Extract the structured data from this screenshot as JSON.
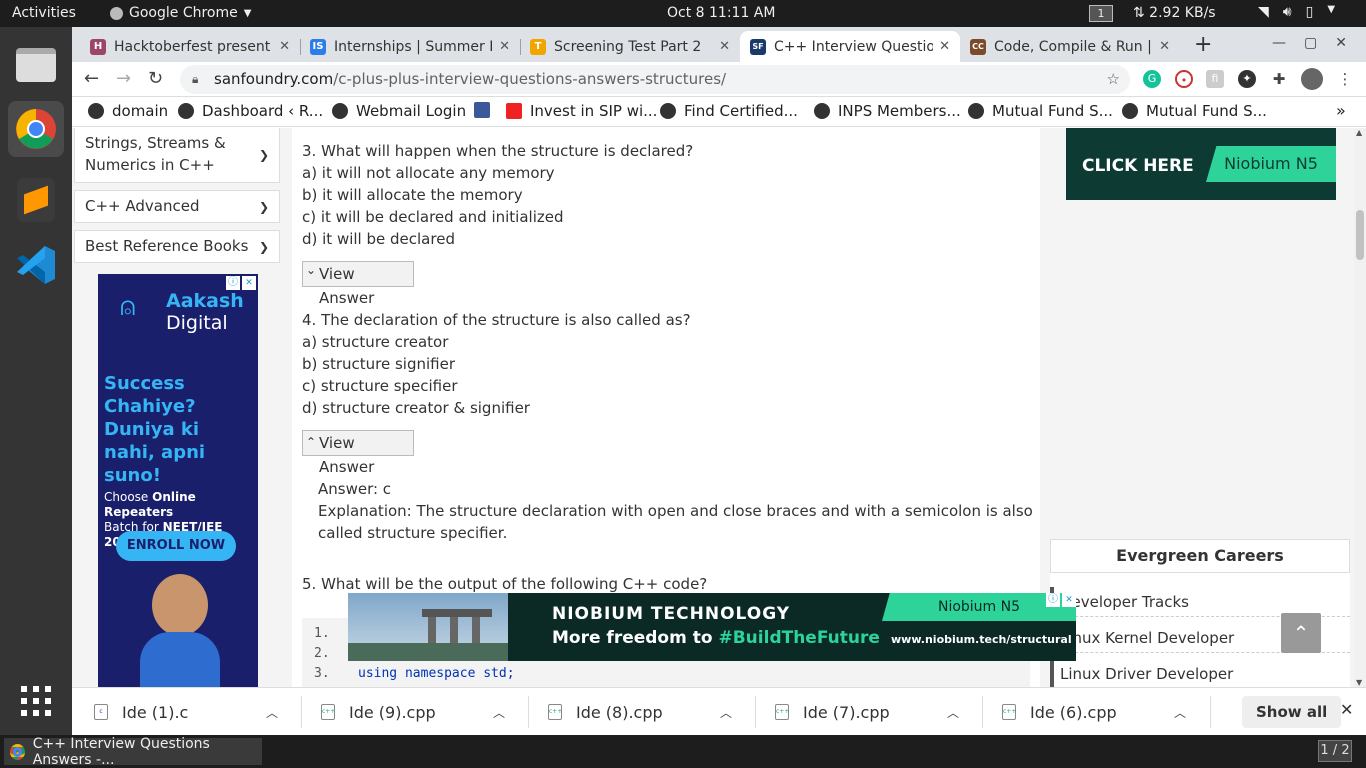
{
  "topbar": {
    "activities": "Activities",
    "app_menu": "Google Chrome",
    "clock": "Oct 8  11:11 AM",
    "workspace": "1",
    "net_speed": "⇅ 2.92 KB/s"
  },
  "tabs": [
    {
      "title": "Hacktoberfest present",
      "fav": "H",
      "fav_color": "#9c4668"
    },
    {
      "title": "Internships | Summer I",
      "fav": "IS",
      "fav_color": "#2b7de9"
    },
    {
      "title": "Screening Test Part 2",
      "fav": "T",
      "fav_color": "#f0a500"
    },
    {
      "title": "C++ Interview Question",
      "fav": "SF",
      "fav_color": "#1a3a6b"
    },
    {
      "title": "Code, Compile & Run |",
      "fav": "CC",
      "fav_color": "#7b4a2a"
    }
  ],
  "url": {
    "host": "sanfoundry.com",
    "path": "/c-plus-plus-interview-questions-answers-structures/"
  },
  "bookmarks": [
    "domain",
    "Dashboard ‹ R...",
    "Webmail Login",
    "Invest in SIP wi...",
    "Find Certified...",
    "INPS Members...",
    "Mutual Fund S...",
    "Mutual Fund S..."
  ],
  "sidebar": {
    "items": [
      "Strings, Streams & Numerics in C++",
      "C++ Advanced",
      "Best Reference Books"
    ]
  },
  "ad_left": {
    "brand1": "Aakash",
    "brand2": "Digital",
    "headline": "Success Chahiye? Duniya ki nahi, apni suno!",
    "sub1": "Choose ",
    "sub1b": "Online Repeaters",
    "sub2": "Batch for ",
    "sub2b": "NEET/JEE 2021",
    "cta": "ENROLL NOW"
  },
  "q3": {
    "question": "3. What will happen when the structure is declared?",
    "a": "a) it will not allocate any memory",
    "b": "b) it will allocate the memory",
    "c": "c) it will be declared and initialized",
    "d": "d) it will be declared"
  },
  "q4": {
    "question": "4. The declaration of the structure is also called as?",
    "a": "a) structure creator",
    "b": "b) structure signifier",
    "c": "c) structure specifier",
    "d": "d) structure creator & signifier"
  },
  "view_answer": "View Answer",
  "answer": {
    "label": "Answer: c",
    "explanation": "Explanation: The structure declaration with open and close braces and with a semicolon is also called structure specifier."
  },
  "q5": {
    "question": "5. What will be the output of the following C++ code?"
  },
  "code": {
    "lines": [
      "1.",
      "2.",
      "3."
    ],
    "line3": "using namespace std;"
  },
  "ad_right": {
    "cta": "CLICK HERE",
    "brand": "Niobium N5"
  },
  "careers": {
    "title": "Evergreen Careers",
    "items": [
      "Developer Tracks",
      "Linux Kernel Developer",
      "Linux Driver Developer"
    ]
  },
  "ad_bottom": {
    "brand": "NIOBIUM TECHNOLOGY",
    "tagline1": "More freedom to ",
    "tagline2": "#BuildTheFuture",
    "logo": "Niobium N5",
    "url": "www.niobium.tech/structural"
  },
  "downloads": [
    "Ide (1).c",
    "Ide (9).cpp",
    "Ide (8).cpp",
    "Ide (7).cpp",
    "Ide (6).cpp"
  ],
  "show_all": "Show all",
  "taskbar": {
    "item": "C++ Interview Questions Answers -...",
    "pager": "1 / 2"
  }
}
